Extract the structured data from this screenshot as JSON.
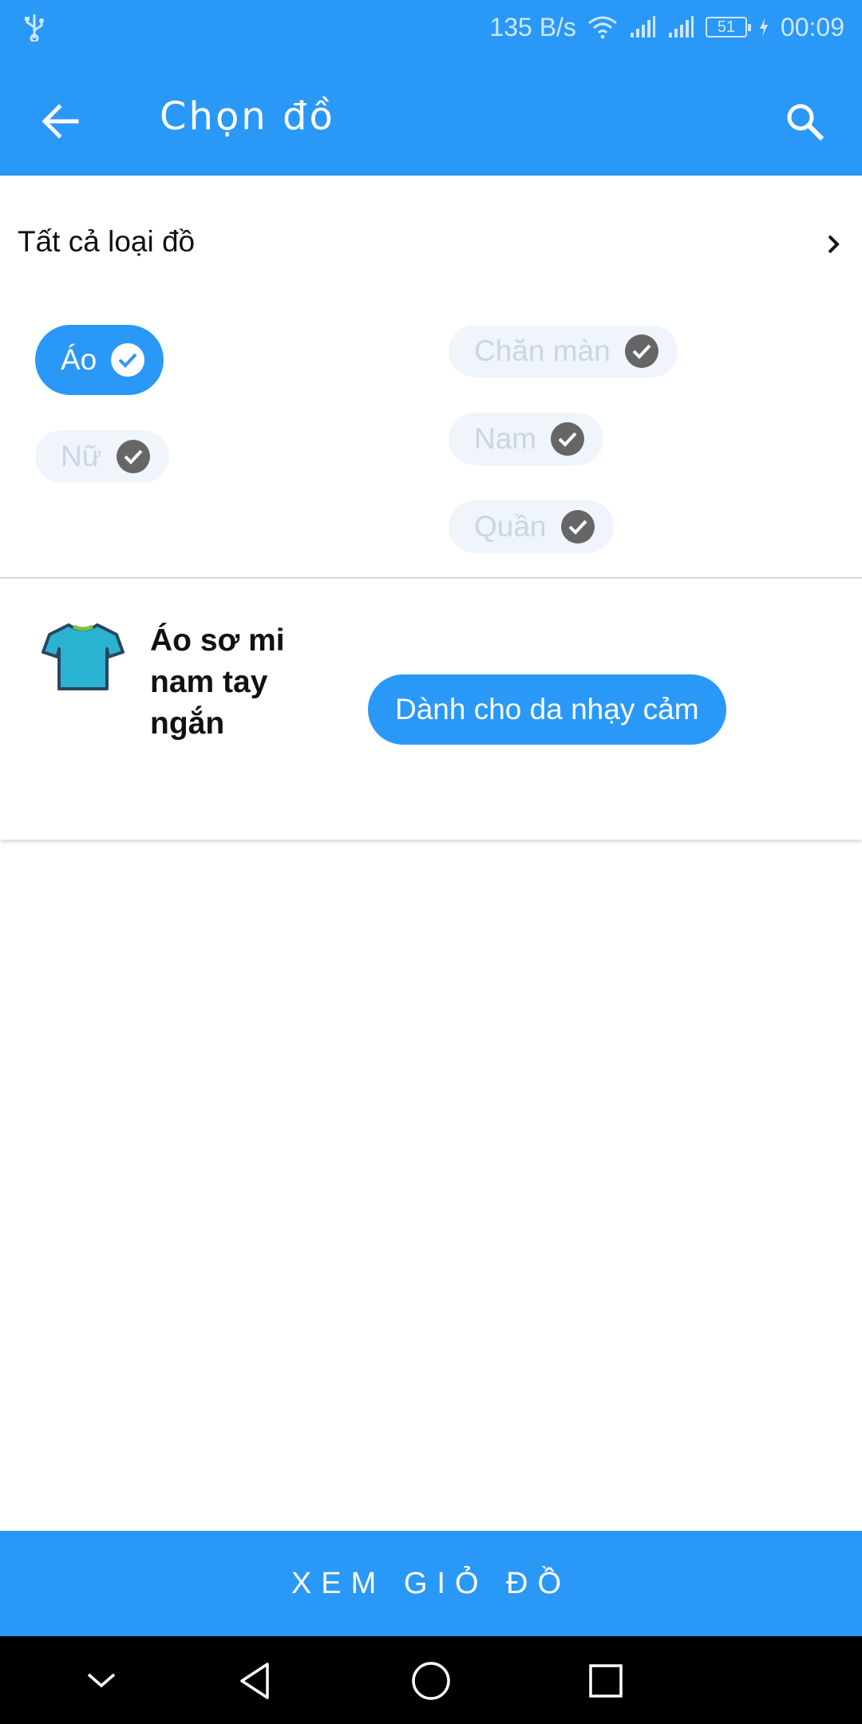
{
  "status_bar": {
    "usb_icon": "usb-icon",
    "speed": "135 B/s",
    "battery": "51",
    "time": "00:09"
  },
  "app_bar": {
    "title": "Chọn đồ",
    "back_icon": "arrow-left-icon",
    "search_icon": "search-icon"
  },
  "filter": {
    "all_label": "Tất cả loại đồ",
    "chips": [
      {
        "label": "Áo",
        "selected": true
      },
      {
        "label": "Chăn màn",
        "selected": false
      },
      {
        "label": "Nữ",
        "selected": false
      },
      {
        "label": "Nam",
        "selected": false
      },
      {
        "label": "Quần",
        "selected": false
      }
    ]
  },
  "item": {
    "icon": "tshirt-icon",
    "name": "Áo sơ mi nam tay ngắn",
    "tag": "Dành cho da nhạy cảm"
  },
  "bottom_button": {
    "label": "XEM GIỎ ĐỒ"
  },
  "colors": {
    "primary": "#2a98f7",
    "chip_unselected_bg": "#f0f5fb",
    "chip_unselected_text": "#c9d6e3",
    "check_dark": "#666666"
  }
}
